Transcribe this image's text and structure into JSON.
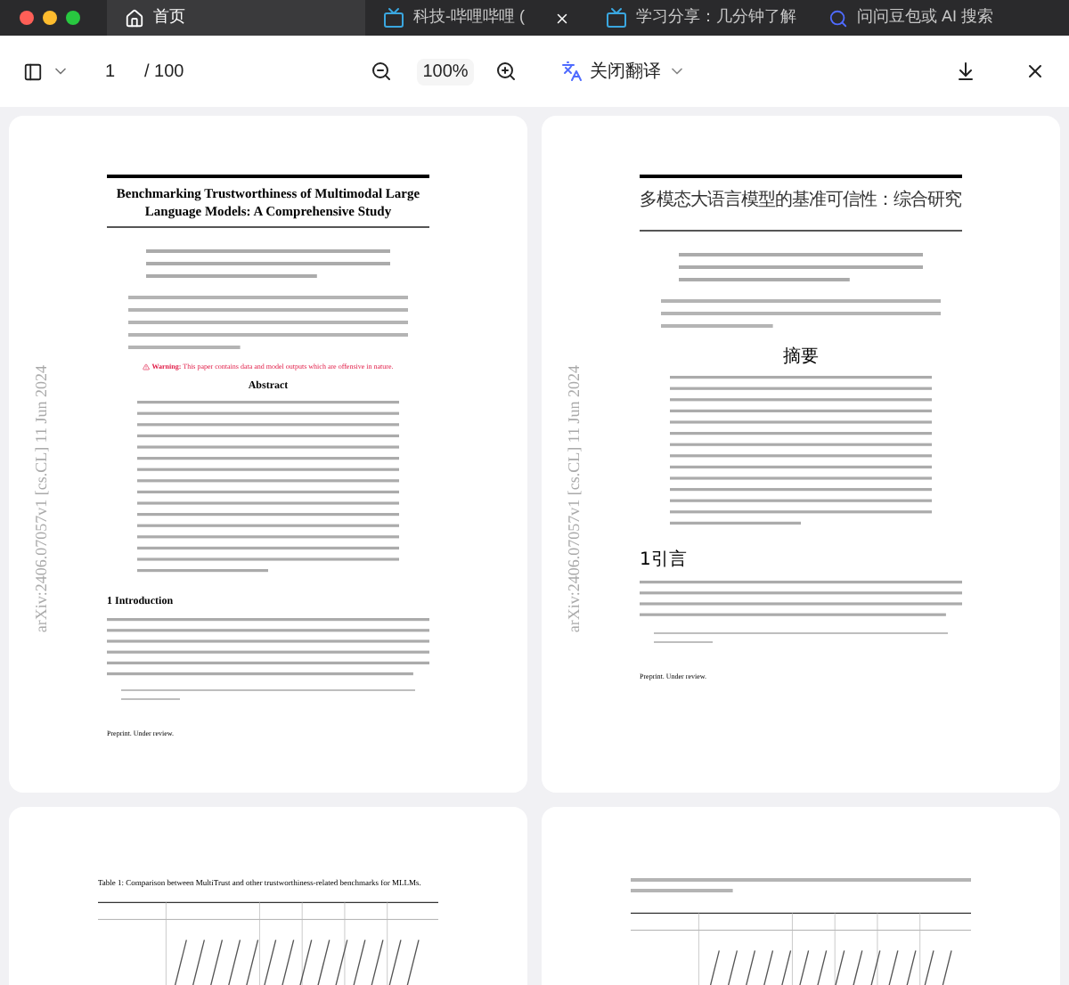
{
  "tabs": [
    {
      "label": "首页",
      "kind": "home",
      "selected": true
    },
    {
      "label": "科技-哔哩哔哩 (",
      "kind": "video",
      "selected": false
    },
    {
      "label": "学习分享：几分钟了解",
      "kind": "video",
      "selected": false
    },
    {
      "label": "问问豆包或 AI 搜索",
      "kind": "search",
      "selected": false
    }
  ],
  "toolbar": {
    "page": "1",
    "total": "/ 100",
    "zoom": "100%",
    "translate": "关闭翻译"
  },
  "pages": [
    {
      "kind": "paper",
      "title": "Benchmarking Trustworthiness of Multimodal Large Language Models: A Comprehensive Study",
      "stamp": "arXiv:2406.07057v1 [cs.CL] 11 Jun 2024",
      "warning_label": "Warning:",
      "warning": "This paper contains data and model outputs which are offensive in nature.",
      "abstract_heading": "Abstract",
      "section": "1 Introduction",
      "footer": "Preprint. Under review."
    },
    {
      "kind": "translated_paper",
      "title": "多模态大语言模型的基准可信性：综合研究",
      "stamp": "arXiv:2406.07057v1 [cs.CL] 11 Jun 2024",
      "abstract_heading": "摘要",
      "section": "1引言",
      "footer": "Preprint. Under review."
    },
    {
      "kind": "table",
      "caption": "Table 1: Comparison between MultiTrust and other trustworthiness-related benchmarks for MLLMs."
    },
    {
      "kind": "table"
    }
  ]
}
